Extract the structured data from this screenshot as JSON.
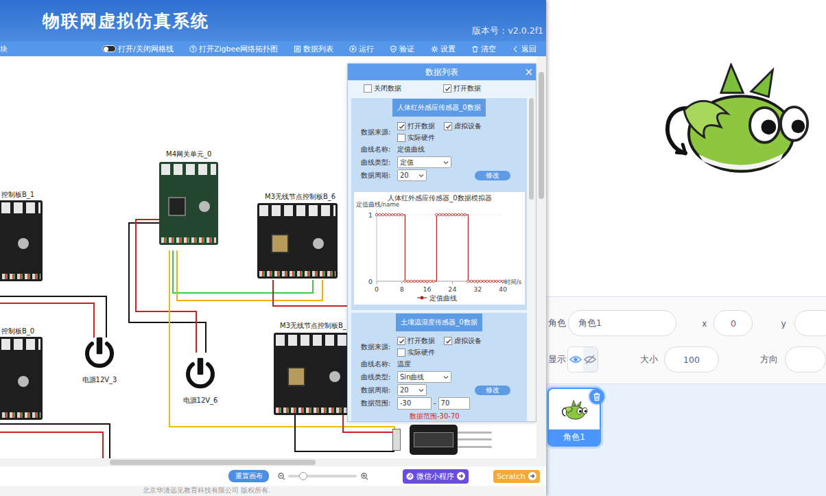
{
  "app": {
    "title": "物联网虚拟仿真系统",
    "version": "版本号：v2.0.2f1"
  },
  "toolbar": {
    "cut_label": "块",
    "items": [
      {
        "label": "打开/关闭网格线",
        "kind": "toggle",
        "on": false
      },
      {
        "label": "打开Zigbee网络拓扑图",
        "kind": "button"
      },
      {
        "label": "数据列表",
        "kind": "button"
      },
      {
        "label": "运行",
        "kind": "button"
      },
      {
        "label": "验证",
        "kind": "button"
      },
      {
        "label": "设置",
        "kind": "button"
      },
      {
        "label": "清空",
        "kind": "button"
      },
      {
        "label": "返回",
        "kind": "button"
      }
    ]
  },
  "canvas": {
    "nodes": [
      {
        "label": "控制板B_1",
        "kind": "board"
      },
      {
        "label": "M4网关单元_0",
        "kind": "gateway"
      },
      {
        "label": "M3无线节点控制板B_6",
        "kind": "board"
      },
      {
        "label": "控制板B_0",
        "kind": "board"
      },
      {
        "label": "M3无线节点控制板B_",
        "kind": "board"
      }
    ],
    "powers": [
      {
        "label": "电源12V_3"
      },
      {
        "label": "电源12V_6"
      }
    ]
  },
  "data_panel": {
    "title": "数据列表",
    "close": "×",
    "options": [
      {
        "label": "关闭数据",
        "checked": false
      },
      {
        "label": "打开数据",
        "checked": true
      }
    ],
    "sections": [
      {
        "title": "人体红外感应传感器_0数据",
        "source_label": "数据来源:",
        "sources": [
          {
            "label": "打开数据",
            "checked": true
          },
          {
            "label": "虚拟设备",
            "checked": true
          },
          {
            "label": "实际硬件",
            "checked": false
          }
        ],
        "fields": [
          {
            "label": "曲线名称:",
            "value": "定值曲线",
            "kind": "text"
          },
          {
            "label": "曲线类型:",
            "value": "定值",
            "kind": "select"
          },
          {
            "label": "数据周期:",
            "value": "20",
            "kind": "select"
          }
        ],
        "modify": "修改",
        "chart": {
          "title": "人体红外感应传感器_0数据模拟器",
          "y_label": "定值曲线/name",
          "y_ticks": [
            "1",
            "0"
          ],
          "x_ticks": [
            "0",
            "8",
            "16",
            "24",
            "32",
            "40"
          ],
          "x_label": "时间/s",
          "series": [
            {
              "name": "定值曲线",
              "values": [
                1,
                1,
                1,
                1,
                1,
                1,
                1,
                1,
                1,
                0,
                0,
                0,
                0,
                0,
                0,
                0,
                0,
                0,
                0,
                1,
                1,
                1,
                1,
                1,
                1,
                1,
                1,
                1,
                1,
                0,
                0,
                0,
                0,
                0,
                0,
                0,
                0,
                0,
                0,
                0,
                0
              ]
            }
          ]
        }
      },
      {
        "title": "土壤温湿度传感器_0数据",
        "source_label": "数据来源:",
        "sources": [
          {
            "label": "打开数据",
            "checked": true
          },
          {
            "label": "虚拟设备",
            "checked": true
          },
          {
            "label": "实际硬件",
            "checked": false
          }
        ],
        "fields": [
          {
            "label": "曲线名称:",
            "value": "温度",
            "kind": "text"
          },
          {
            "label": "曲线类型:",
            "value": "Sin曲线",
            "kind": "select"
          },
          {
            "label": "数据周期:",
            "value": "20",
            "kind": "select"
          }
        ],
        "modify": "修改",
        "range": {
          "label": "数据范围:",
          "min": "-30",
          "separator": "-",
          "max": "70",
          "note": "数据范围-30-70"
        }
      }
    ]
  },
  "zoom": {
    "reset": "重置画布",
    "level": 0.22
  },
  "links": [
    {
      "label": "微信小程序"
    },
    {
      "label": "Scratch"
    }
  ],
  "footer": "北京华清远见教育科技有限公司 版权所有.",
  "sprite_info": {
    "name_label": "角色",
    "name": "角色1",
    "x_label": "x",
    "x": "0",
    "y_label": "y",
    "show_label": "显示",
    "visible": true,
    "size_label": "大小",
    "size": "100",
    "direction_label": "方向"
  },
  "sprites": [
    {
      "name": "角色1",
      "selected": true
    }
  ]
}
